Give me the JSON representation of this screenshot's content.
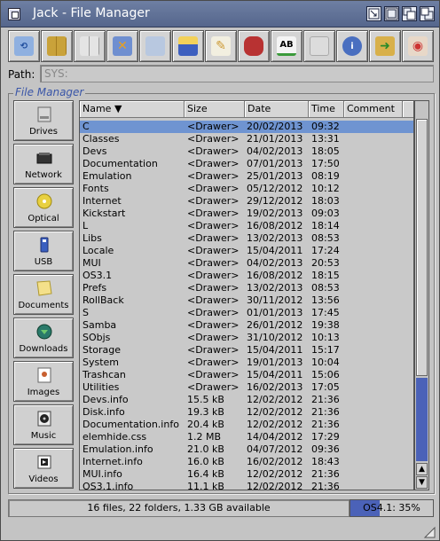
{
  "window": {
    "title": "Jack - File Manager"
  },
  "path": {
    "label": "Path:",
    "value": "SYS:"
  },
  "group_title": "File Manager",
  "toolbar": [
    {
      "icon": "refresh-icon"
    },
    {
      "icon": "grid-icon"
    },
    {
      "icon": "grid-gray-icon"
    },
    {
      "icon": "network-icon"
    },
    {
      "icon": "copy-icon"
    },
    {
      "icon": "disk-icon"
    },
    {
      "icon": "edit-icon"
    },
    {
      "icon": "delete-icon"
    },
    {
      "icon": "rename-icon",
      "text": "AB"
    },
    {
      "icon": "blank-icon"
    },
    {
      "icon": "info-icon"
    },
    {
      "icon": "execute-icon"
    },
    {
      "icon": "view-icon"
    }
  ],
  "sidebar": [
    {
      "label": "Drives",
      "icon": "drive-icon"
    },
    {
      "label": "Network",
      "icon": "network-drive-icon"
    },
    {
      "label": "Optical",
      "icon": "optical-icon"
    },
    {
      "label": "USB",
      "icon": "usb-icon"
    },
    {
      "label": "Documents",
      "icon": "documents-icon"
    },
    {
      "label": "Downloads",
      "icon": "downloads-icon"
    },
    {
      "label": "Images",
      "icon": "images-icon"
    },
    {
      "label": "Music",
      "icon": "music-icon"
    },
    {
      "label": "Videos",
      "icon": "videos-icon"
    }
  ],
  "columns": {
    "name": "Name ▼",
    "size": "Size",
    "date": "Date",
    "time": "Time",
    "comment": "Comment"
  },
  "files": [
    {
      "name": "C",
      "size": "<Drawer>",
      "date": "20/02/2013",
      "time": "09:32",
      "selected": true
    },
    {
      "name": "Classes",
      "size": "<Drawer>",
      "date": "21/01/2013",
      "time": "13:31"
    },
    {
      "name": "Devs",
      "size": "<Drawer>",
      "date": "04/02/2013",
      "time": "18:05"
    },
    {
      "name": "Documentation",
      "size": "<Drawer>",
      "date": "07/01/2013",
      "time": "17:50"
    },
    {
      "name": "Emulation",
      "size": "<Drawer>",
      "date": "25/01/2013",
      "time": "08:19"
    },
    {
      "name": "Fonts",
      "size": "<Drawer>",
      "date": "05/12/2012",
      "time": "10:12"
    },
    {
      "name": "Internet",
      "size": "<Drawer>",
      "date": "29/12/2012",
      "time": "18:03"
    },
    {
      "name": "Kickstart",
      "size": "<Drawer>",
      "date": "19/02/2013",
      "time": "09:03"
    },
    {
      "name": "L",
      "size": "<Drawer>",
      "date": "16/08/2012",
      "time": "18:14"
    },
    {
      "name": "Libs",
      "size": "<Drawer>",
      "date": "13/02/2013",
      "time": "08:53"
    },
    {
      "name": "Locale",
      "size": "<Drawer>",
      "date": "15/04/2011",
      "time": "17:24"
    },
    {
      "name": "MUI",
      "size": "<Drawer>",
      "date": "04/02/2013",
      "time": "20:53"
    },
    {
      "name": "OS3.1",
      "size": "<Drawer>",
      "date": "16/08/2012",
      "time": "18:15"
    },
    {
      "name": "Prefs",
      "size": "<Drawer>",
      "date": "13/02/2013",
      "time": "08:53"
    },
    {
      "name": "RollBack",
      "size": "<Drawer>",
      "date": "30/11/2012",
      "time": "13:56"
    },
    {
      "name": "S",
      "size": "<Drawer>",
      "date": "01/01/2013",
      "time": "17:45"
    },
    {
      "name": "Samba",
      "size": "<Drawer>",
      "date": "26/01/2012",
      "time": "19:38"
    },
    {
      "name": "SObjs",
      "size": "<Drawer>",
      "date": "31/10/2012",
      "time": "10:13"
    },
    {
      "name": "Storage",
      "size": "<Drawer>",
      "date": "15/04/2011",
      "time": "15:17"
    },
    {
      "name": "System",
      "size": "<Drawer>",
      "date": "19/01/2013",
      "time": "10:04"
    },
    {
      "name": "Trashcan",
      "size": "<Drawer>",
      "date": "15/04/2011",
      "time": "15:06"
    },
    {
      "name": "Utilities",
      "size": "<Drawer>",
      "date": "16/02/2013",
      "time": "17:05"
    },
    {
      "name": "Devs.info",
      "size": "15.5 kB",
      "date": "12/02/2012",
      "time": "21:36"
    },
    {
      "name": "Disk.info",
      "size": "19.3 kB",
      "date": "12/02/2012",
      "time": "21:36"
    },
    {
      "name": "Documentation.info",
      "size": "20.4 kB",
      "date": "12/02/2012",
      "time": "21:36"
    },
    {
      "name": "elemhide.css",
      "size": "1.2 MB",
      "date": "14/04/2012",
      "time": "17:29"
    },
    {
      "name": "Emulation.info",
      "size": "21.0 kB",
      "date": "04/07/2012",
      "time": "09:36"
    },
    {
      "name": "Internet.info",
      "size": "16.0 kB",
      "date": "16/02/2012",
      "time": "18:43"
    },
    {
      "name": "MUI.info",
      "size": "16.4 kB",
      "date": "12/02/2012",
      "time": "21:36"
    },
    {
      "name": "OS3.1.info",
      "size": "11.1 kB",
      "date": "12/02/2012",
      "time": "21:36"
    }
  ],
  "status": {
    "text": "16 files, 22 folders, 1.33 GB available"
  },
  "gauge": {
    "label": "OS4.1: 35%",
    "fraction": 0.35,
    "color": "#4b62b8"
  }
}
